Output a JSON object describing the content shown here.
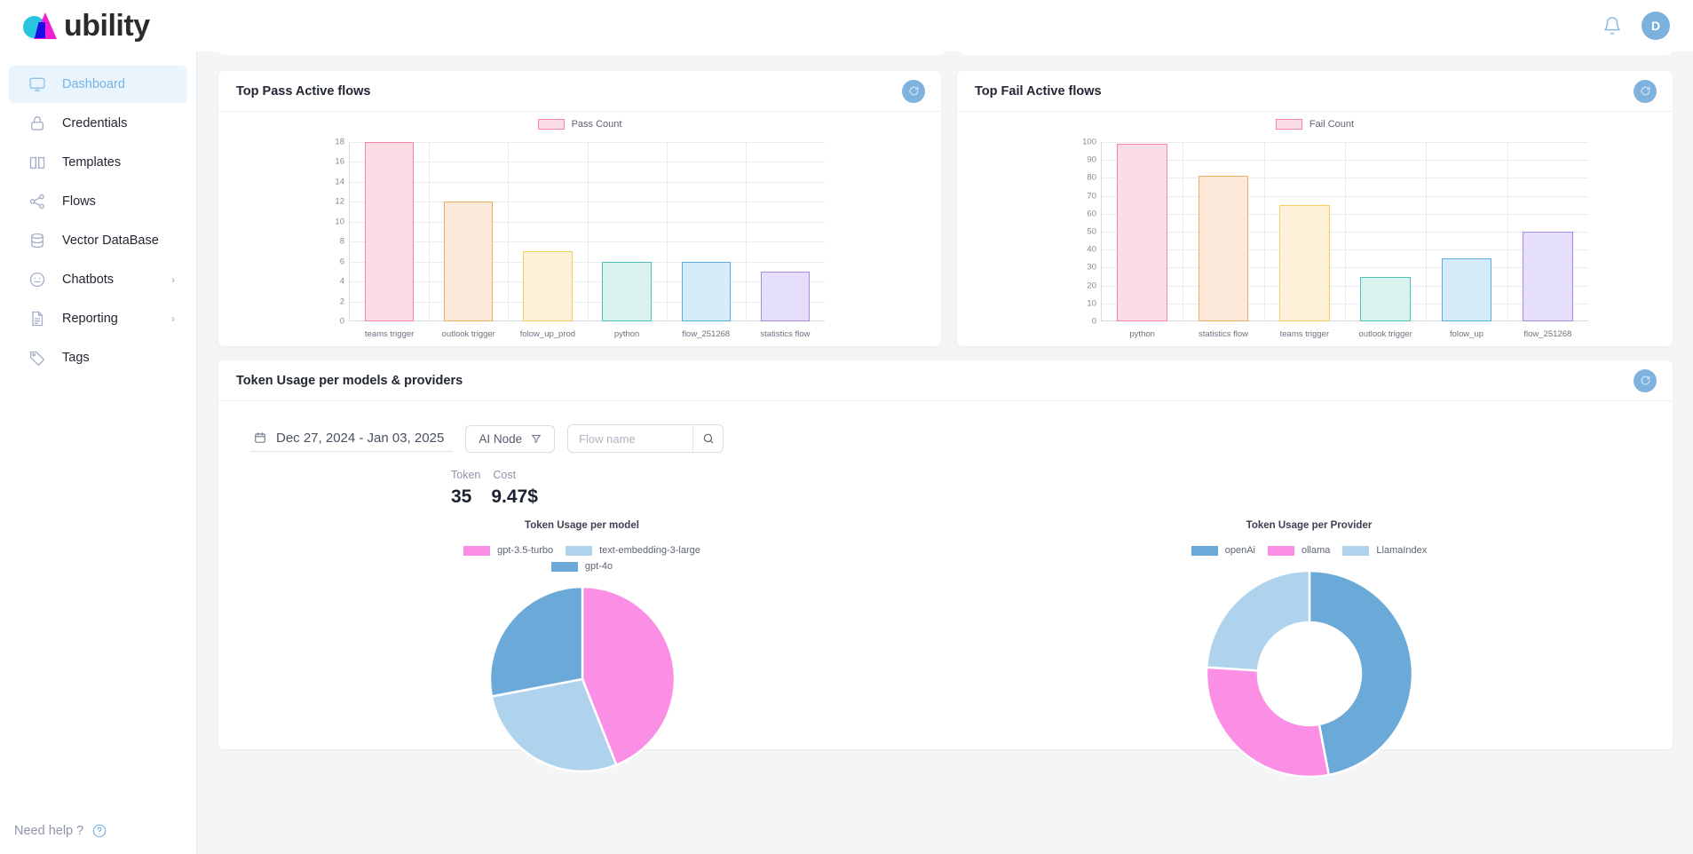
{
  "app": {
    "brand": "ubility",
    "avatar_initial": "D",
    "notifications_icon": "bell-icon"
  },
  "sidebar": {
    "items": [
      {
        "label": "Dashboard",
        "icon": "monitor-icon",
        "active": true,
        "expandable": false
      },
      {
        "label": "Credentials",
        "icon": "lock-icon",
        "active": false,
        "expandable": false
      },
      {
        "label": "Templates",
        "icon": "book-icon",
        "active": false,
        "expandable": false
      },
      {
        "label": "Flows",
        "icon": "share-icon",
        "active": false,
        "expandable": false
      },
      {
        "label": "Vector DataBase",
        "icon": "database-icon",
        "active": false,
        "expandable": false
      },
      {
        "label": "Chatbots",
        "icon": "smiley-icon",
        "active": false,
        "expandable": true
      },
      {
        "label": "Reporting",
        "icon": "report-icon",
        "active": false,
        "expandable": true
      },
      {
        "label": "Tags",
        "icon": "tag-icon",
        "active": false,
        "expandable": false
      }
    ],
    "help_label": "Need help ?",
    "help_icon": "question-circle-icon"
  },
  "cards": {
    "pass": {
      "title": "Top Pass Active flows",
      "refresh_icon": "refresh-icon"
    },
    "fail": {
      "title": "Top Fail Active flows",
      "refresh_icon": "refresh-icon"
    },
    "token": {
      "title": "Token Usage per models & providers",
      "refresh_icon": "refresh-icon"
    }
  },
  "token_panel": {
    "date_range": "Dec 27, 2024 - Jan 03, 2025",
    "calendar_icon": "calendar-icon",
    "node_filter": "AI Node",
    "filter_icon": "funnel-icon",
    "search_placeholder": "Flow name",
    "search_value": "",
    "search_icon": "search-icon",
    "kpis": [
      {
        "label": "Token",
        "value": "35"
      },
      {
        "label": "Cost",
        "value": "9.47$"
      }
    ]
  },
  "chart_data": [
    {
      "type": "bar",
      "title": "Top Pass Active flows",
      "legend": [
        {
          "name": "Pass Count",
          "fill": "#fbdde5",
          "stroke": "#f486a6"
        }
      ],
      "legend_position": "top-center",
      "categories": [
        "teams trigger",
        "outlook trigger",
        "folow_up_prod",
        "python",
        "flow_251268",
        "statistics flow"
      ],
      "values": [
        18,
        12,
        7,
        6,
        6,
        5
      ],
      "bar_colors": [
        {
          "fill": "#fbdde5",
          "stroke": "#f486a6"
        },
        {
          "fill": "#fdeada",
          "stroke": "#f2ab5d"
        },
        {
          "fill": "#fdf2d9",
          "stroke": "#f3cd5d"
        },
        {
          "fill": "#d9f2ee",
          "stroke": "#4dc3b4"
        },
        {
          "fill": "#d7ecfa",
          "stroke": "#56b0e8"
        },
        {
          "fill": "#e6dffb",
          "stroke": "#a98ae8"
        }
      ],
      "ylabel": "",
      "xlabel": "",
      "ylim": [
        0,
        18
      ],
      "yticks": [
        0,
        2,
        4,
        6,
        8,
        10,
        12,
        14,
        16,
        18
      ],
      "grid": true
    },
    {
      "type": "bar",
      "title": "Top Fail Active flows",
      "legend": [
        {
          "name": "Fail Count",
          "fill": "#fbdde5",
          "stroke": "#f486a6"
        }
      ],
      "legend_position": "top-center",
      "categories": [
        "python",
        "statistics flow",
        "teams trigger",
        "outlook trigger",
        "folow_up",
        "flow_251268"
      ],
      "values": [
        99,
        81,
        65,
        25,
        35,
        50
      ],
      "bar_colors": [
        {
          "fill": "#fbdde5",
          "stroke": "#f486a6"
        },
        {
          "fill": "#fdeada",
          "stroke": "#f2ab5d"
        },
        {
          "fill": "#fdf2d9",
          "stroke": "#f3cd5d"
        },
        {
          "fill": "#d9f2ee",
          "stroke": "#4dc3b4"
        },
        {
          "fill": "#d7ecfa",
          "stroke": "#56b0e8"
        },
        {
          "fill": "#e6dffb",
          "stroke": "#a98ae8"
        }
      ],
      "ylabel": "",
      "xlabel": "",
      "ylim": [
        0,
        100
      ],
      "yticks": [
        0,
        10,
        20,
        30,
        40,
        50,
        60,
        70,
        80,
        90,
        100
      ],
      "grid": true
    },
    {
      "type": "pie",
      "title": "Token Usage per model",
      "labels": [
        "gpt-3.5-turbo",
        "text-embedding-3-large",
        "gpt-4o"
      ],
      "values": [
        44,
        28,
        28
      ],
      "colors": [
        "#fb8fe6",
        "#afd3ec",
        "#6aa9d8"
      ],
      "legend_position": "top-center",
      "donut": false
    },
    {
      "type": "pie",
      "title": "Token Usage per Provider",
      "labels": [
        "openAi",
        "ollama",
        "LlamaIndex"
      ],
      "values": [
        47,
        29,
        24
      ],
      "colors": [
        "#6aa9d8",
        "#fb8fe6",
        "#afd3ec"
      ],
      "legend_position": "top-center",
      "donut": true
    }
  ]
}
